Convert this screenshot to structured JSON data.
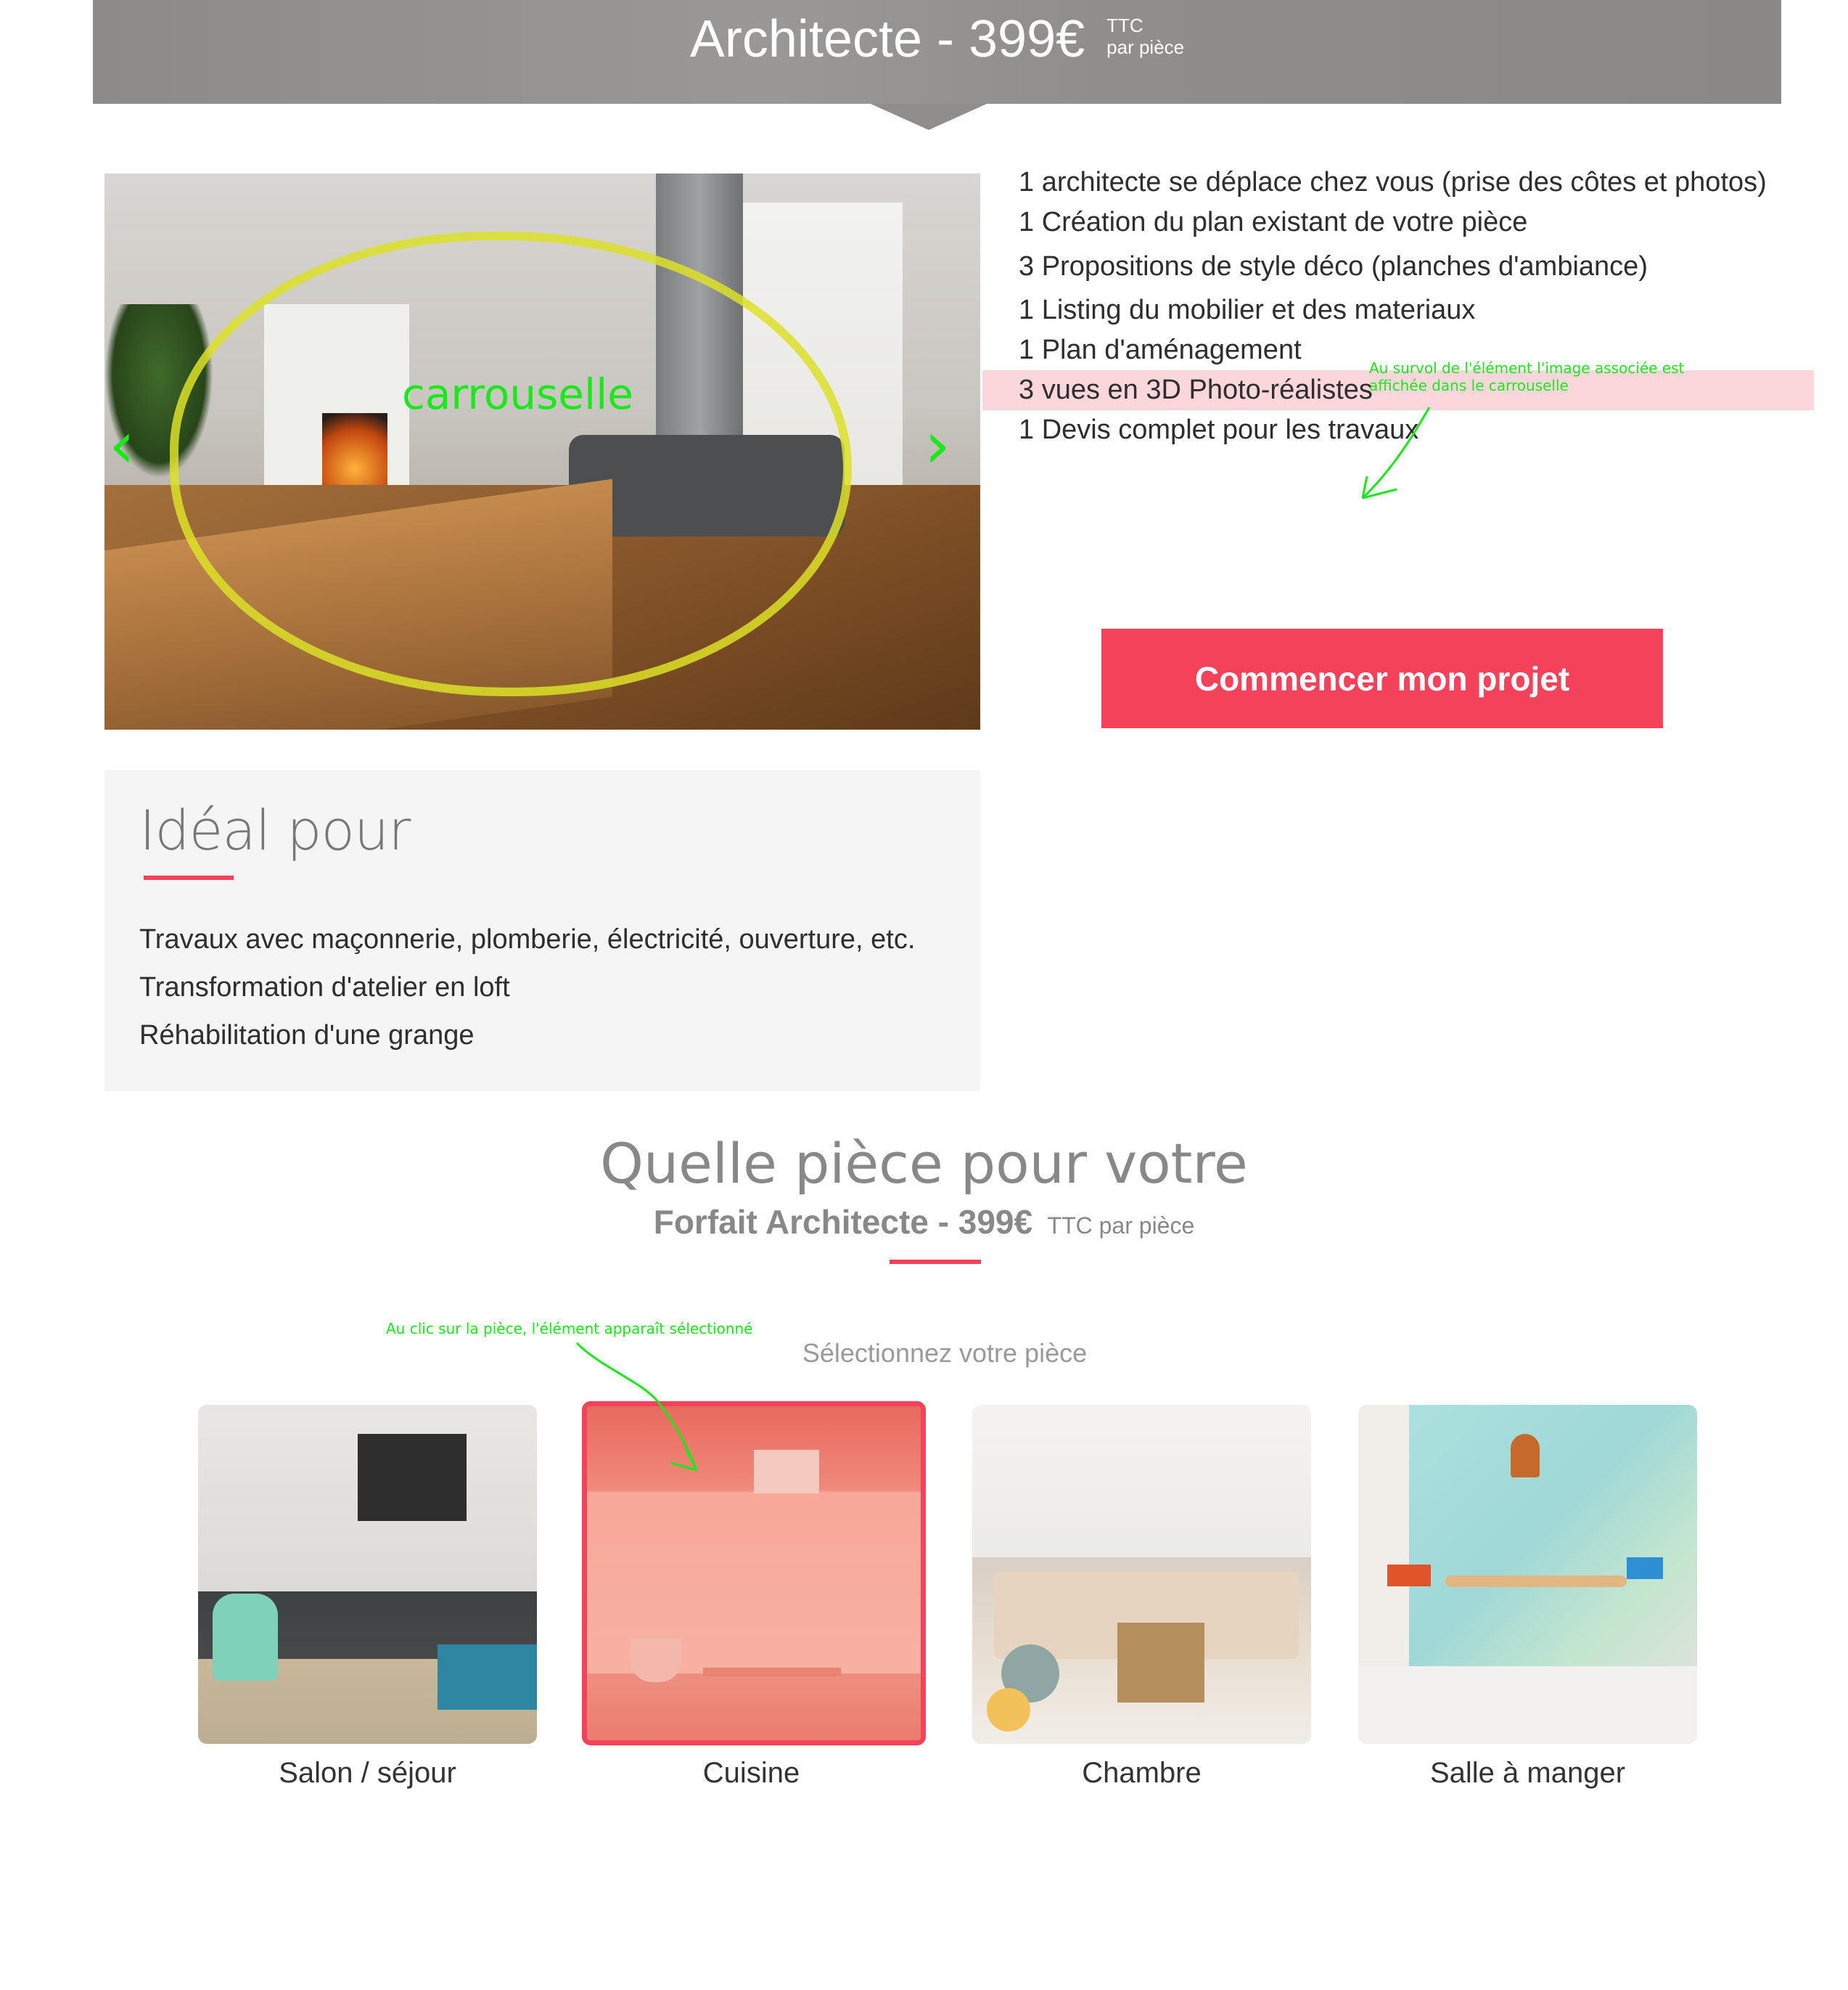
{
  "header": {
    "title": "Architecte - 399€",
    "ttc": "TTC",
    "per": "par pièce"
  },
  "carousel": {
    "label": "carrouselle",
    "prev_icon": "chevron-left-icon",
    "next_icon": "chevron-right-icon",
    "prev_glyph": "‹",
    "next_glyph": "›"
  },
  "features": [
    "1 architecte se déplace chez vous (prise des côtes et photos)",
    "1 Création du plan existant de votre pièce",
    "3 Propositions de style déco  (planches d'ambiance)",
    "1 Listing du mobilier et des materiaux",
    "1 Plan d'aménagement",
    "3 vues en 3D Photo-réalistes",
    "1 Devis complet pour les travaux"
  ],
  "hover_note": "Au survol de l'élément l'image associée est affichée dans le carrouselle",
  "cta": "Commencer mon projet",
  "ideal": {
    "title": "Idéal pour",
    "items": [
      "Travaux avec maçonnerie, plomberie, électricité, ouverture, etc.",
      "Transformation d'atelier en loft",
      "Réhabilitation d'une grange"
    ]
  },
  "section": {
    "title": "Quelle pièce pour votre",
    "subtitle": "Forfait Architecte - 399€",
    "subtitle_small": "TTC par pièce",
    "select_label": "Sélectionnez votre pièce",
    "click_note": "Au clic sur la pièce, l'élément apparaît sélectionné"
  },
  "rooms": [
    {
      "label": "Salon / séjour",
      "selected": false
    },
    {
      "label": "Cuisine",
      "selected": true
    },
    {
      "label": "Chambre",
      "selected": false
    },
    {
      "label": "Salle à manger",
      "selected": false
    }
  ],
  "colors": {
    "accent": "#f4425a",
    "annotation": "#19e819",
    "highlight_row": "#fbd7dc"
  }
}
